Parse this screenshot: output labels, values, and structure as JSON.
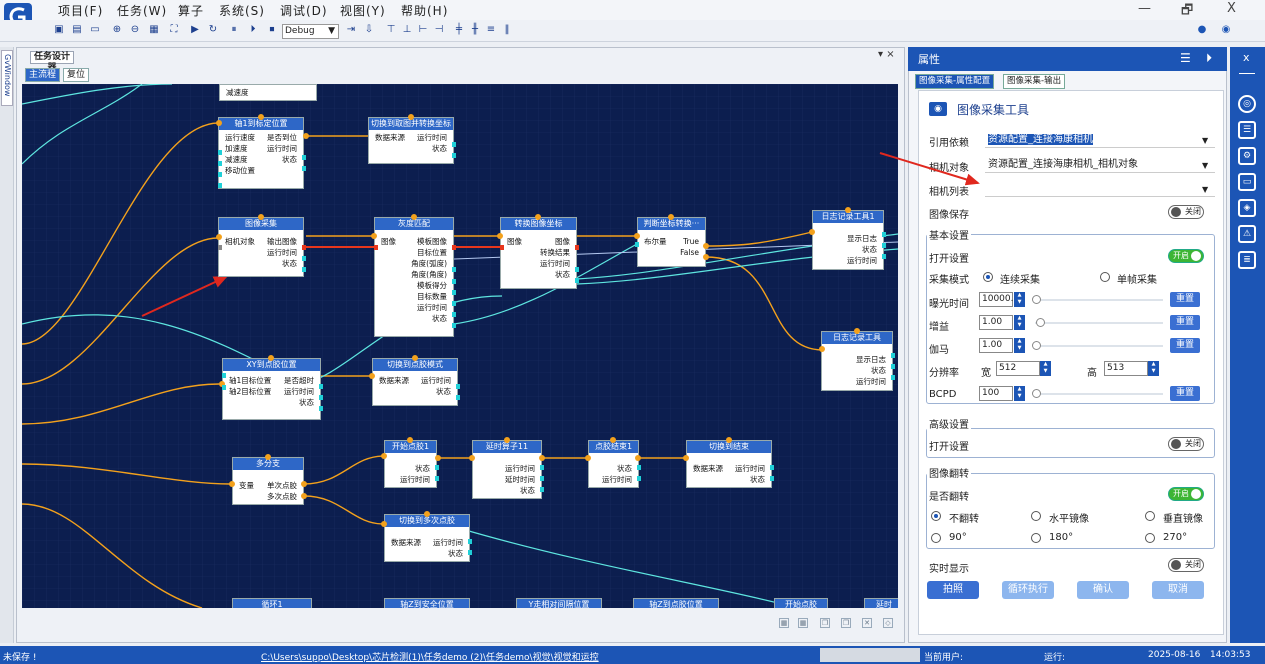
{
  "menu": [
    "项目(F)",
    "任务(W)",
    "算子",
    "系统(S)",
    "调试(D)",
    "视图(Y)",
    "帮助(H)"
  ],
  "window_controls": [
    "—",
    "🗗",
    "X"
  ],
  "toolbar": {
    "debug_mode": "Debug"
  },
  "left_side_tab": "GvWindow",
  "doc_tab": "任务设计器",
  "doc_close": "▾ ×",
  "sub_tabs": [
    "主流程",
    "复位"
  ],
  "nodes": {
    "decel": {
      "title": "",
      "left": [
        "减速度"
      ],
      "right": []
    },
    "axis1": {
      "title": "轴1到标定位置",
      "left": [
        "运行速度",
        "加速度",
        "减速度",
        "移动位置"
      ],
      "right": [
        "是否到位",
        "运行时间",
        "状态"
      ]
    },
    "switch1": {
      "title": "切换到取图并转换坐标",
      "left": [
        "数据来源"
      ],
      "right": [
        "运行时间",
        "状态"
      ]
    },
    "capture": {
      "title": "图像采集",
      "left": [
        "相机对象"
      ],
      "right": [
        "输出图像",
        "运行时间",
        "状态"
      ]
    },
    "gray": {
      "title": "灰度匹配",
      "left": [
        "图像"
      ],
      "right": [
        "模板图像",
        "目标位置",
        "角度(弧度)",
        "角度(角度)",
        "模板得分",
        "目标数量",
        "运行时间",
        "状态"
      ]
    },
    "convert": {
      "title": "转换图像坐标",
      "left": [
        "图像"
      ],
      "right": [
        "图像",
        "转换结果",
        "运行时间",
        "状态"
      ]
    },
    "judge": {
      "title": "判断坐标转换···",
      "left": [
        "布尔量"
      ],
      "right": [
        "True",
        "False"
      ]
    },
    "log1": {
      "title": "日志记录工具1",
      "left": [],
      "right": [
        "显示日志",
        "状态",
        "运行时间"
      ]
    },
    "log2": {
      "title": "日志记录工具",
      "left": [],
      "right": [
        "显示日志",
        "状态",
        "运行时间"
      ]
    },
    "xy": {
      "title": "XY到点胶位置",
      "left": [
        "轴1目标位置",
        "轴2目标位置"
      ],
      "right": [
        "是否超时",
        "运行时间",
        "状态"
      ]
    },
    "switch2": {
      "title": "切换到点胶模式",
      "left": [
        "数据来源"
      ],
      "right": [
        "运行时间",
        "状态"
      ]
    },
    "branch": {
      "title": "多分支",
      "left": [
        "变量"
      ],
      "right": [
        "单次点胶",
        "多次点胶"
      ]
    },
    "start1": {
      "title": "开始点胶1",
      "left": [],
      "right": [
        "状态",
        "运行时间"
      ]
    },
    "delay": {
      "title": "延时算子11",
      "left": [],
      "right": [
        "运行时间",
        "延时时间",
        "状态"
      ]
    },
    "end1": {
      "title": "点胶结束1",
      "left": [],
      "right": [
        "状态",
        "运行时间"
      ]
    },
    "switchEnd": {
      "title": "切换到结束",
      "left": [
        "数据来源"
      ],
      "right": [
        "运行时间",
        "状态"
      ]
    },
    "switch3": {
      "title": "切换到多次点胶",
      "left": [
        "数据来源"
      ],
      "right": [
        "运行时间",
        "状态"
      ]
    },
    "loop": {
      "title": "循环1",
      "left": [],
      "right": []
    },
    "axis2": {
      "title": "轴Z到安全位置",
      "left": [],
      "right": []
    },
    "ywait": {
      "title": "Y走相对间隔位置",
      "left": [],
      "right": []
    },
    "axisZ": {
      "title": "轴Z到点胶位置",
      "left": [],
      "right": []
    },
    "start2": {
      "title": "开始点胶",
      "left": [],
      "right": []
    },
    "delay2": {
      "title": "延时",
      "left": [],
      "right": []
    }
  },
  "props": {
    "header": "属性",
    "tabs": [
      "图像采集-属性配置",
      "图像采集-输出"
    ],
    "tool_title": "图像采集工具",
    "ref_label": "引用依赖",
    "ref_value": "资源配置_连接海康相机",
    "cam_obj_label": "相机对象",
    "cam_obj_value": "资源配置_连接海康相机_相机对象",
    "cam_list_label": "相机列表",
    "save_label": "图像保存",
    "off": "关闭",
    "on": "开启",
    "basic": "基本设置",
    "open_setting": "打开设置",
    "mode_label": "采集模式",
    "mode_cont": "连续采集",
    "mode_single": "单帧采集",
    "exposure_label": "曝光时间",
    "exposure_value": "10000.0",
    "gain_label": "增益",
    "gain_value": "1.00",
    "gamma_label": "伽马",
    "gamma_value": "1.00",
    "res_label": "分辨率",
    "width_label": "宽",
    "width_value": "512",
    "height_label": "高",
    "height_value": "513",
    "bcpd_label": "BCPD",
    "bcpd_value": "100",
    "reset": "重置",
    "advanced": "高级设置",
    "adv_open": "打开设置",
    "flip": "图像翻转",
    "flip_q": "是否翻转",
    "no_flip": "不翻转",
    "h_mirror": "水平镜像",
    "v_mirror": "垂直镜像",
    "r90": "90°",
    "r180": "180°",
    "r270": "270°",
    "realtime": "实时显示",
    "btn_shoot": "拍照",
    "btn_loop": "循环执行",
    "btn_ok": "确认",
    "btn_cancel": "取消"
  },
  "status": {
    "unsaved": "未保存 !",
    "path": "C:\\Users\\suppo\\Desktop\\芯片检测(1)\\任务demo (2)\\任务demo\\视觉\\视觉和运控",
    "user": "当前用户:",
    "run": "运行:",
    "date": "2025-08-16",
    "time": "14:03:53"
  },
  "colors": {
    "accent": "#1C55B5",
    "canvas": "#0C1E4F",
    "node_header": "#2E67C7",
    "wire_orange": "#F3A11C",
    "wire_cyan": "#5EE6E0",
    "wire_red": "#E8361C",
    "arrow": "#E0281E"
  }
}
